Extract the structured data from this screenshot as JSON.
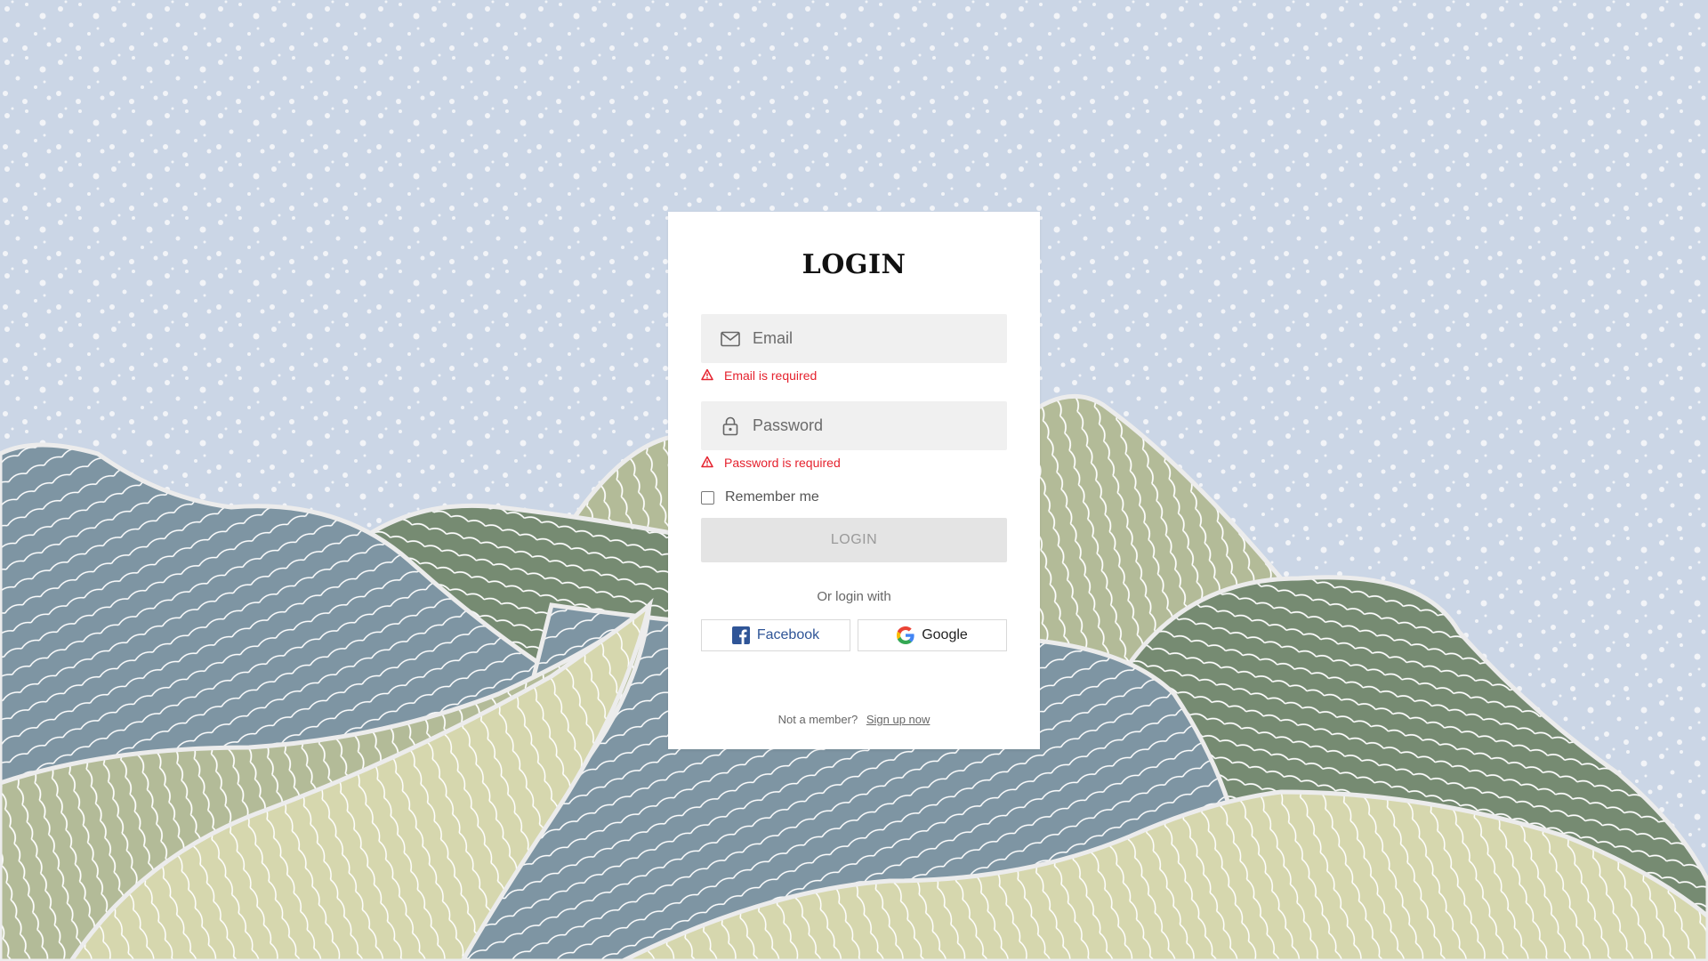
{
  "login": {
    "title": "LOGIN",
    "email": {
      "placeholder": "Email",
      "value": "",
      "error": "Email is required",
      "icon": "mail-icon"
    },
    "password": {
      "placeholder": "Password",
      "value": "",
      "error": "Password is required",
      "icon": "lock-icon"
    },
    "remember_label": "Remember me",
    "remember_checked": false,
    "submit_label": "LOGIN",
    "social_prompt": "Or login with",
    "facebook_label": "Facebook",
    "google_label": "Google",
    "footer_text": "Not a member?",
    "signup_link": "Sign up now"
  },
  "colors": {
    "background_sky": "#cbd6e6",
    "error": "#e5222e",
    "facebook": "#2f5597"
  }
}
